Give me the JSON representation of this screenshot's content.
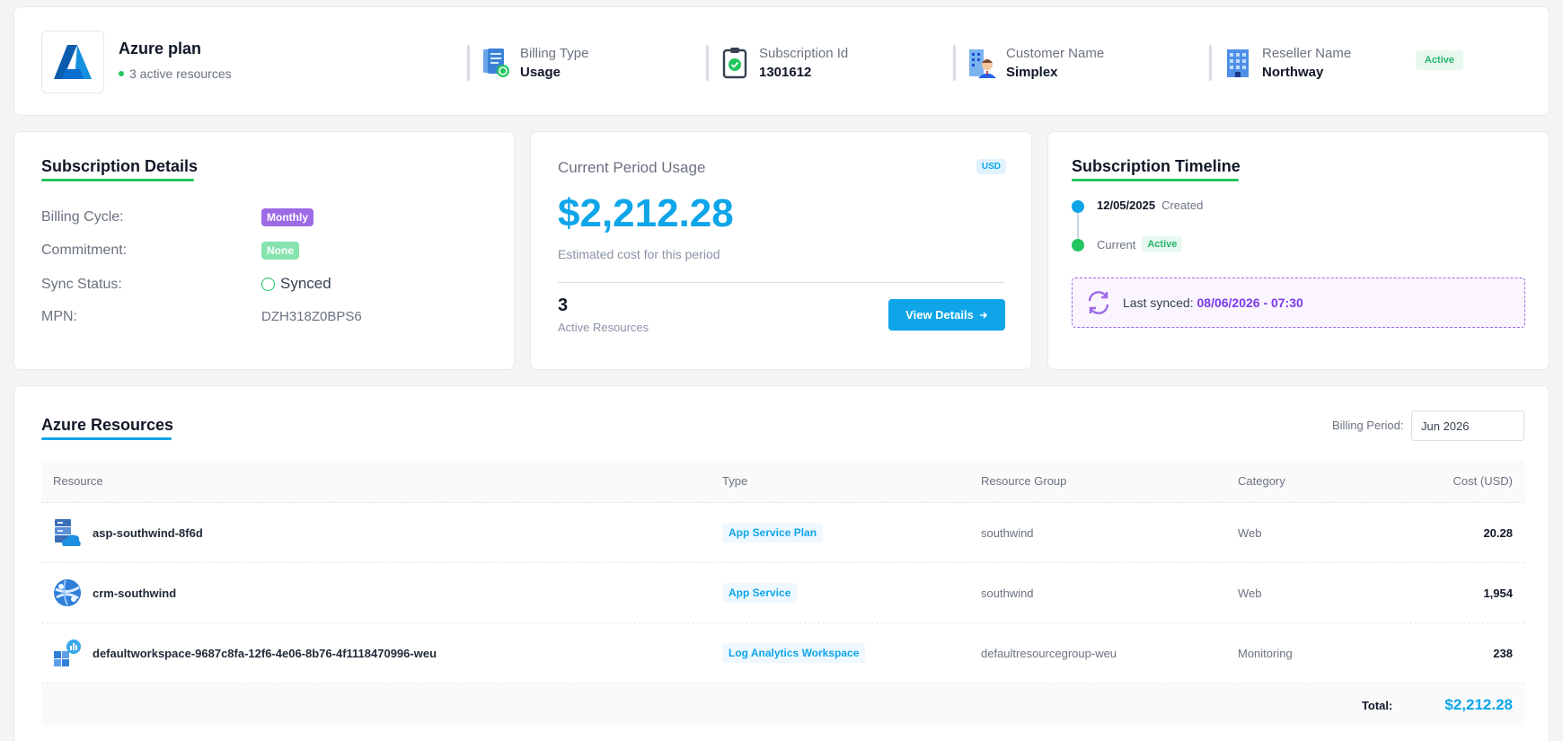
{
  "header": {
    "plan_title": "Azure plan",
    "plan_subtitle": "3 active resources",
    "billing_type_label": "Billing Type",
    "billing_type_value": "Usage",
    "subscription_id_label": "Subscription Id",
    "subscription_id_value": "1301612",
    "customer_name_label": "Customer Name",
    "customer_name_value": "Simplex",
    "reseller_name_label": "Reseller Name",
    "reseller_name_value": "Northway",
    "status": "Active"
  },
  "details": {
    "title": "Subscription Details",
    "billing_cycle_label": "Billing Cycle:",
    "billing_cycle_value": "Monthly",
    "commitment_label": "Commitment:",
    "commitment_value": "None",
    "sync_status_label": "Sync Status:",
    "sync_status_value": "Synced",
    "mpn_label": "MPN:",
    "mpn_value": "DZH318Z0BPS6"
  },
  "usage": {
    "title": "Current Period Usage",
    "currency": "USD",
    "amount": "$2,212.28",
    "subtitle": "Estimated cost for this period",
    "resource_count": "3",
    "resource_label": "Active Resources",
    "button_label": "View Details",
    "button_icon": "arrow-right-icon"
  },
  "timeline": {
    "title": "Subscription Timeline",
    "created_date": "12/05/2025",
    "created_label": "Created",
    "current_label": "Current",
    "current_status": "Active",
    "last_synced_label": "Last synced:",
    "last_synced_value": "08/06/2026 - 07:30"
  },
  "resources": {
    "title": "Azure Resources",
    "billing_period_label": "Billing Period:",
    "billing_period_value": "Jun 2026",
    "columns": [
      "Resource",
      "Type",
      "Resource Group",
      "Category",
      "Cost (USD)"
    ],
    "rows": [
      {
        "name": "asp-southwind-8f6d",
        "type": "App Service Plan",
        "group": "southwind",
        "category": "Web",
        "cost": "20.28",
        "icon": "app-service-plan-icon"
      },
      {
        "name": "crm-southwind",
        "type": "App Service",
        "group": "southwind",
        "category": "Web",
        "cost": "1,954",
        "icon": "app-service-icon"
      },
      {
        "name": "defaultworkspace-9687c8fa-12f6-4e06-8b76-4f1118470996-weu",
        "type": "Log Analytics Workspace",
        "group": "defaultresourcegroup-weu",
        "category": "Monitoring",
        "cost": "238",
        "icon": "log-analytics-icon"
      }
    ],
    "total_label": "Total:",
    "total_value": "$2,212.28"
  },
  "colors": {
    "accent_blue": "#0ea5e9",
    "accent_green": "#22c55e",
    "accent_purple": "#9d6ae6"
  }
}
